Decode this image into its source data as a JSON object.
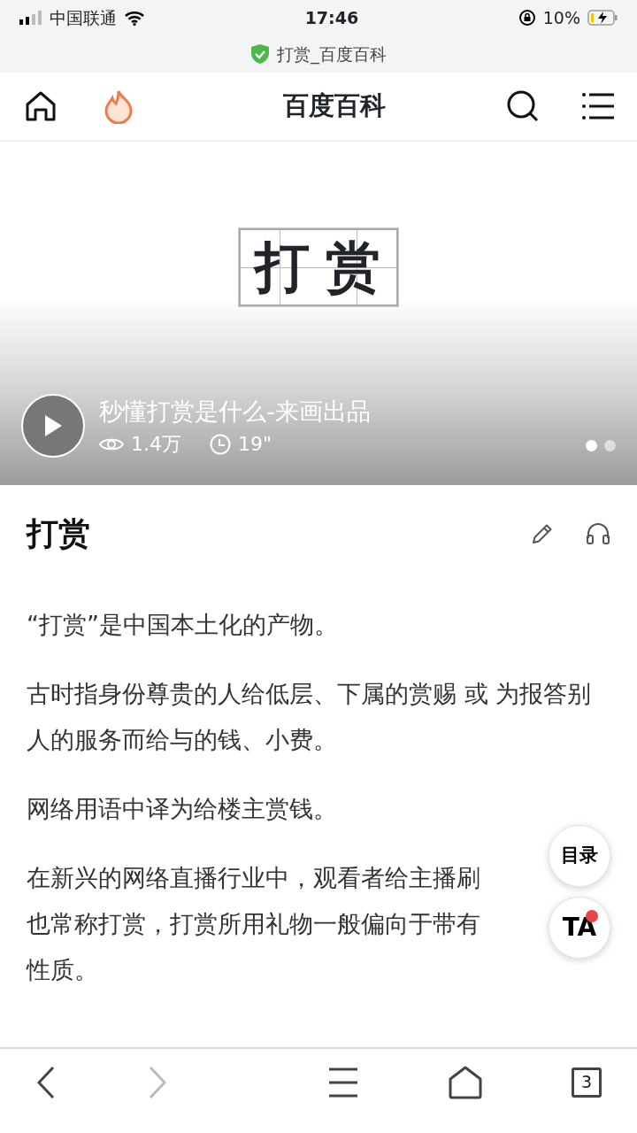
{
  "status_bar": {
    "carrier": "中国联通",
    "time": "17:46",
    "battery": "10%",
    "charging": true
  },
  "address_bar": {
    "title": "打赏_百度百科",
    "secure": true
  },
  "header": {
    "title": "百度百科"
  },
  "hero": {
    "cover_text": "打赏",
    "video_title": "秒懂打赏是什么-来画出品",
    "views": "1.4万",
    "duration": "19\"",
    "slides": [
      {
        "selected": true
      },
      {
        "selected": false
      }
    ]
  },
  "article": {
    "title": "打赏",
    "paragraphs": [
      "“打赏”是中国本土化的产物。",
      "古时指身份尊贵的人给低层、下属的赏赐 或 为报答别人的服务而给与的钱、小费。",
      "网络用语中译为给楼主赏钱。",
      {
        "kind": "covered",
        "lines": [
          "在新兴的网络直播行业中，观看者给主播刷",
          "也常称打赏，打赏所用礼物一般偏向于带有",
          "性质。"
        ]
      }
    ]
  },
  "floating": {
    "toc_label": "目录",
    "ta_label": "TA",
    "ta_unread": true
  },
  "toolbar": {
    "back_disabled": false,
    "forward_disabled": true,
    "tab_count": "3"
  }
}
